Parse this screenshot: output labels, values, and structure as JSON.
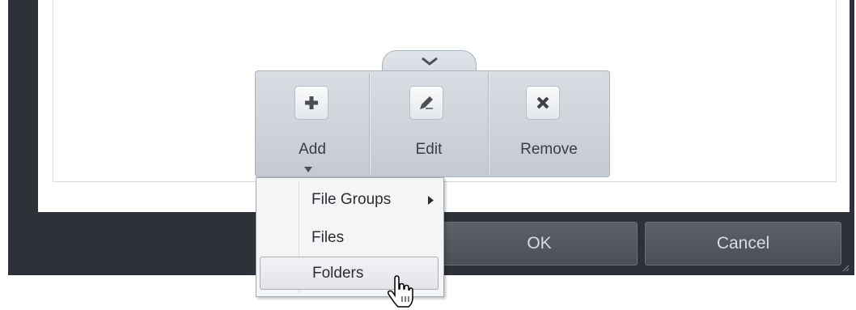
{
  "toolbar": {
    "add_label": "Add",
    "edit_label": "Edit",
    "remove_label": "Remove",
    "add_icon": "plus-icon",
    "edit_icon": "pencil-icon",
    "remove_icon": "x-icon"
  },
  "add_menu": {
    "items": [
      {
        "label": "File Groups",
        "has_submenu": true
      },
      {
        "label": "Files",
        "has_submenu": false
      },
      {
        "label": "Folders",
        "has_submenu": false,
        "hovered": true
      }
    ]
  },
  "footer": {
    "ok_label": "OK",
    "cancel_label": "Cancel"
  },
  "colors": {
    "window_bg": "#2e3137",
    "toolbar_bg": "#d0d5db",
    "button_text": "#d8dbe0"
  }
}
